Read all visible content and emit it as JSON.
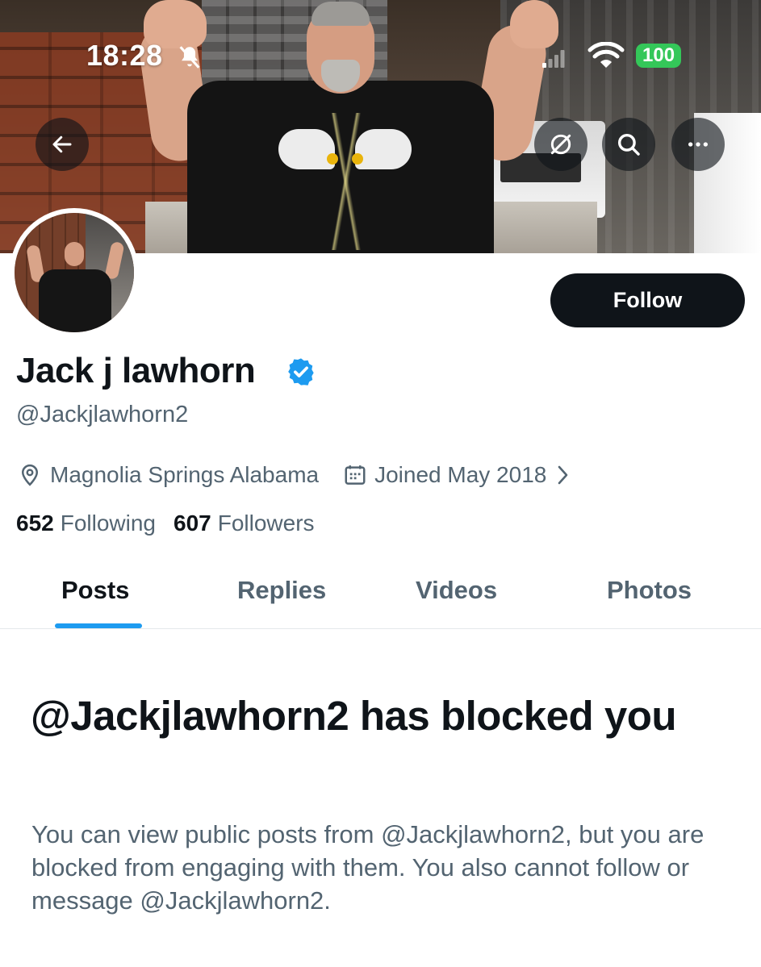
{
  "status_bar": {
    "time": "18:28",
    "battery": "100",
    "icons": [
      "bell-slash-icon",
      "signal-icon",
      "wifi-icon"
    ]
  },
  "header": {
    "icons": [
      "arrow-left-icon",
      "grok-icon",
      "search-icon",
      "more-icon"
    ]
  },
  "profile": {
    "follow_label": "Follow",
    "display_name": "Jack j lawhorn",
    "handle": "@Jackjlawhorn2",
    "verified": true,
    "location": "Magnolia Springs Alabama",
    "joined": "Joined May 2018",
    "following_count": "652",
    "following_label": "Following",
    "followers_count": "607",
    "followers_label": "Followers"
  },
  "tabs": [
    {
      "label": "Posts",
      "active": true
    },
    {
      "label": "Replies",
      "active": false
    },
    {
      "label": "Videos",
      "active": false
    },
    {
      "label": "Photos",
      "active": false
    }
  ],
  "blocked": {
    "title": "@Jackjlawhorn2 has blocked you",
    "body": "You can view public posts from @Jackjlawhorn2, but you are blocked from engaging with them. You also cannot follow or message @Jackjlawhorn2."
  },
  "colors": {
    "accent": "#1d9bf0",
    "text_primary": "#0f1419",
    "text_secondary": "#536471",
    "battery": "#34c759",
    "verified": "#1d9bf0"
  }
}
